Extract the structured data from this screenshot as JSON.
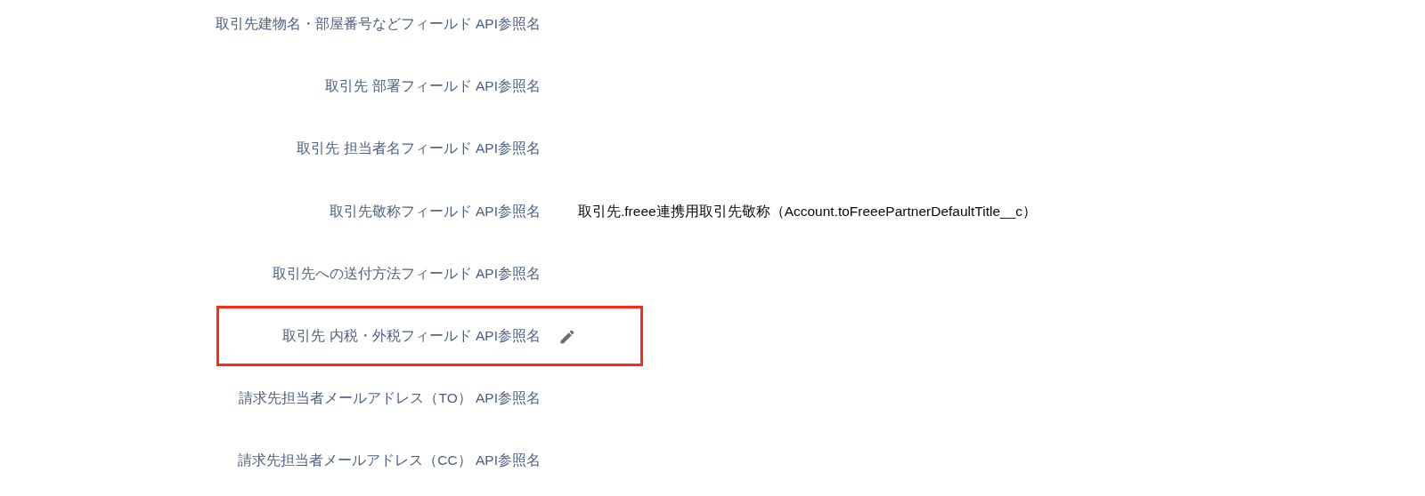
{
  "rows": [
    {
      "label": "取引先建物名・部屋番号などフィールド API参照名",
      "editable": false,
      "highlighted": false
    },
    {
      "label": "取引先 部署フィールド API参照名",
      "editable": false,
      "highlighted": false
    },
    {
      "label": "取引先 担当者名フィールド API参照名",
      "editable": false,
      "highlighted": false
    },
    {
      "label": "取引先敬称フィールド API参照名",
      "value": "取引先.freee連携用取引先敬称（Account.toFreeePartnerDefaultTitle__c）",
      "editable": false,
      "highlighted": false
    },
    {
      "label": "取引先への送付方法フィールド API参照名",
      "editable": false,
      "highlighted": false
    },
    {
      "label": "取引先 内税・外税フィールド API参照名",
      "editable": true,
      "highlighted": true
    },
    {
      "label": "請求先担当者メールアドレス（TO） API参照名",
      "editable": false,
      "highlighted": false
    },
    {
      "label": "請求先担当者メールアドレス（CC） API参照名",
      "editable": false,
      "highlighted": false
    }
  ]
}
